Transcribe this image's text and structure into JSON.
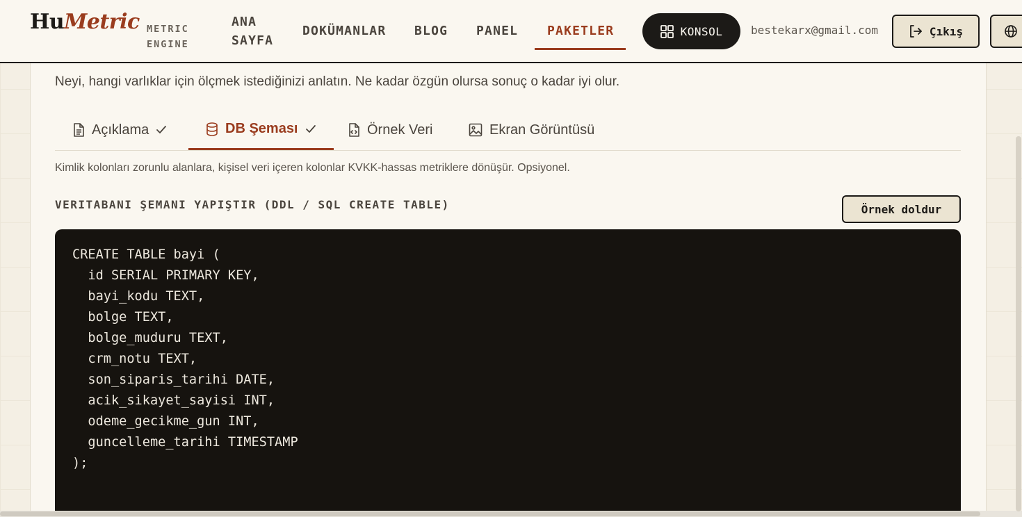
{
  "brand": {
    "logo_main": "Hu",
    "logo_accent": "Metric",
    "tagline_line1": "METRIC",
    "tagline_line2": "ENGINE"
  },
  "nav": {
    "links": [
      {
        "label_line1": "ANA",
        "label_line2": "SAYFA"
      },
      {
        "label": "DOKÜMANLAR"
      },
      {
        "label": "BLOG"
      },
      {
        "label": "PANEL"
      },
      {
        "label": "PAKETLER",
        "active": true
      }
    ],
    "konsol_label": "KONSOL",
    "user_email": "bestekarx@gmail.com",
    "logout_label": "Çıkış"
  },
  "intro": {
    "text": "Neyi, hangi varlıklar için ölçmek istediğinizi anlatın. Ne kadar özgün olursa sonuç o kadar iyi olur."
  },
  "tabs": [
    {
      "label": "Açıklama",
      "icon": "document-icon",
      "done": true
    },
    {
      "label": "DB Şeması",
      "icon": "database-icon",
      "done": true,
      "active": true
    },
    {
      "label": "Örnek Veri",
      "icon": "code-file-icon",
      "done": false
    },
    {
      "label": "Ekran Görüntüsü",
      "icon": "image-icon",
      "done": false
    }
  ],
  "schema": {
    "hint": "Kimlik kolonları zorunlu alanlara, kişisel veri içeren kolonlar KVKK-hassas metriklere dönüşür. Opsiyonel.",
    "label": "VERITABANI ŞEMANI YAPIŞTIR (DDL / SQL CREATE TABLE)",
    "sample_button": "Örnek doldur",
    "code_lines": [
      "CREATE TABLE bayi (",
      "  id SERIAL PRIMARY KEY,",
      "  bayi_kodu TEXT,",
      "  bolge TEXT,",
      "  bolge_muduru TEXT,",
      "  crm_notu TEXT,",
      "  son_siparis_tarihi DATE,",
      "  acik_sikayet_sayisi INT,",
      "  odeme_gecikme_gun INT,",
      "  guncelleme_tarihi TIMESTAMP",
      ");"
    ]
  },
  "colors": {
    "accent": "#9a3c1e",
    "dark": "#1c1a17",
    "paper": "#faf7f0"
  }
}
